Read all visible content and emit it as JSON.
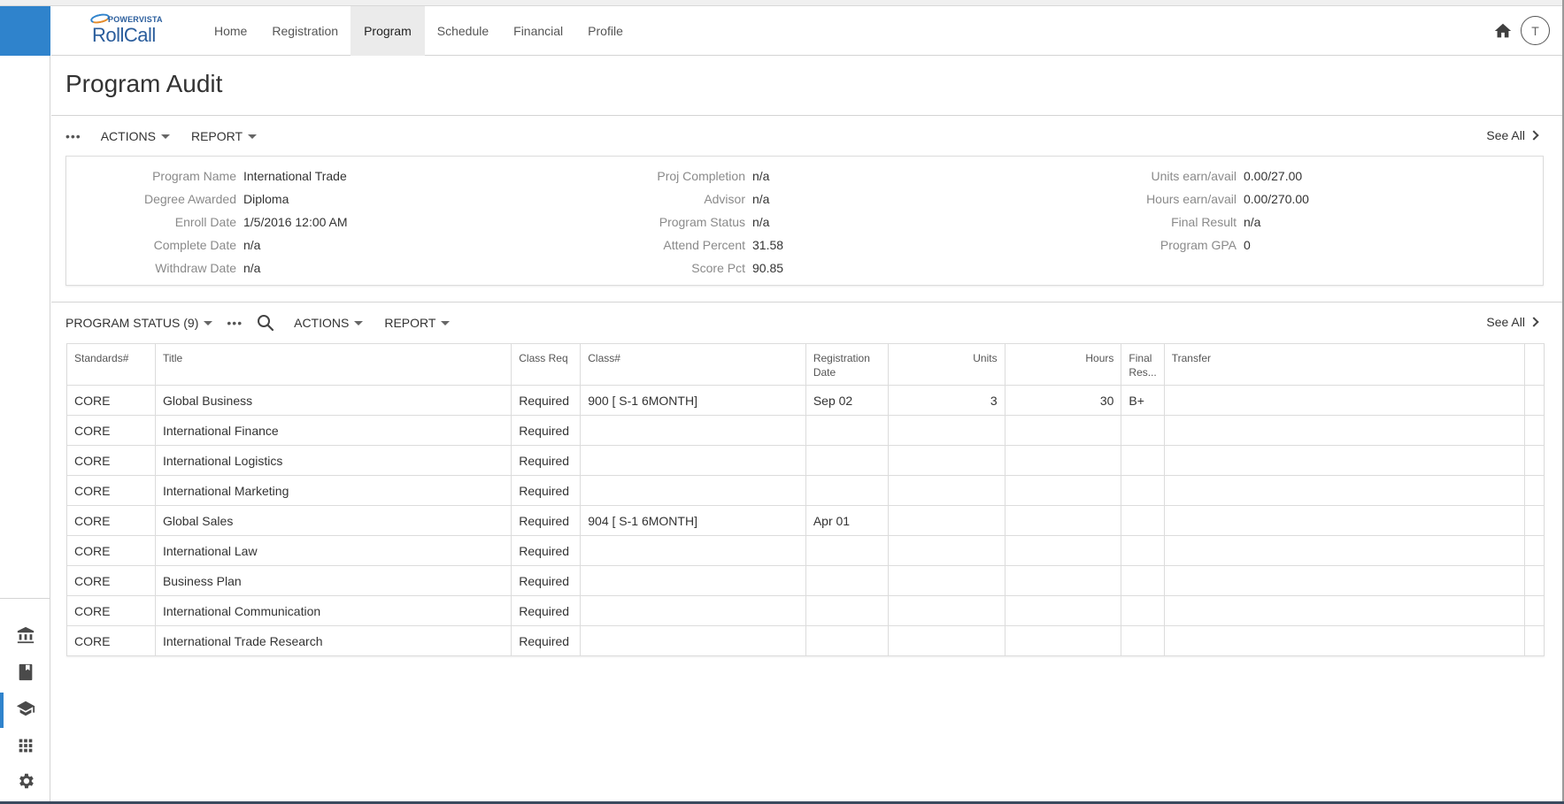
{
  "app": {
    "logo_top": "POWERVISTA",
    "logo_main": "RollCall"
  },
  "nav": {
    "tabs": [
      {
        "label": "Home"
      },
      {
        "label": "Registration"
      },
      {
        "label": "Program",
        "active": true
      },
      {
        "label": "Schedule"
      },
      {
        "label": "Financial"
      },
      {
        "label": "Profile"
      }
    ],
    "avatar_initial": "T"
  },
  "rail": {
    "items": [
      {
        "icon": "institution-icon"
      },
      {
        "icon": "book-icon"
      },
      {
        "icon": "graduation-cap-icon",
        "active": true
      },
      {
        "icon": "apps-grid-icon"
      },
      {
        "icon": "gear-icon"
      }
    ]
  },
  "page": {
    "title": "Program Audit"
  },
  "summary_toolbar": {
    "more": "•••",
    "actions": "ACTIONS",
    "report": "REPORT",
    "see_all": "See All"
  },
  "summary": {
    "col1": [
      {
        "label": "Program Name",
        "value": "International Trade"
      },
      {
        "label": "Degree Awarded",
        "value": "Diploma"
      },
      {
        "label": "Enroll Date",
        "value": "1/5/2016 12:00 AM"
      },
      {
        "label": "Complete Date",
        "value": "n/a"
      },
      {
        "label": "Withdraw Date",
        "value": "n/a"
      }
    ],
    "col2": [
      {
        "label": "Proj Completion",
        "value": "n/a"
      },
      {
        "label": "Advisor",
        "value": "n/a"
      },
      {
        "label": "Program Status",
        "value": "n/a"
      },
      {
        "label": "Attend Percent",
        "value": "31.58"
      },
      {
        "label": "Score Pct",
        "value": "90.85"
      }
    ],
    "col3": [
      {
        "label": "Units earn/avail",
        "value": "0.00/27.00"
      },
      {
        "label": "Hours earn/avail",
        "value": "0.00/270.00"
      },
      {
        "label": "Final Result",
        "value": "n/a"
      },
      {
        "label": "Program GPA",
        "value": "0"
      }
    ]
  },
  "status_toolbar": {
    "title": "PROGRAM STATUS (9)",
    "more": "•••",
    "actions": "ACTIONS",
    "report": "REPORT",
    "see_all": "See All"
  },
  "table": {
    "headers": [
      "Standards#",
      "Title",
      "Class Req",
      "Class#",
      "Registration Date",
      "Units",
      "Hours",
      "Final Res...",
      "Transfer",
      ""
    ],
    "rows": [
      [
        "CORE",
        "Global Business",
        "Required",
        "900 [ S-1 6MONTH]",
        "Sep 02",
        "3",
        "30",
        "B+",
        "",
        ""
      ],
      [
        "CORE",
        "International Finance",
        "Required",
        "",
        "",
        "",
        "",
        "",
        "",
        ""
      ],
      [
        "CORE",
        "International Logistics",
        "Required",
        "",
        "",
        "",
        "",
        "",
        "",
        ""
      ],
      [
        "CORE",
        "International Marketing",
        "Required",
        "",
        "",
        "",
        "",
        "",
        "",
        ""
      ],
      [
        "CORE",
        "Global Sales",
        "Required",
        "904 [ S-1 6MONTH]",
        "Apr 01",
        "",
        "",
        "",
        "",
        ""
      ],
      [
        "CORE",
        "International Law",
        "Required",
        "",
        "",
        "",
        "",
        "",
        "",
        ""
      ],
      [
        "CORE",
        "Business Plan",
        "Required",
        "",
        "",
        "",
        "",
        "",
        "",
        ""
      ],
      [
        "CORE",
        "International Communication",
        "Required",
        "",
        "",
        "",
        "",
        "",
        "",
        ""
      ],
      [
        "CORE",
        "International Trade Research",
        "Required",
        "",
        "",
        "",
        "",
        "",
        "",
        ""
      ]
    ]
  },
  "colors": {
    "brand_blue": "#2f83cc",
    "active_tab_bg": "#ebebeb"
  }
}
